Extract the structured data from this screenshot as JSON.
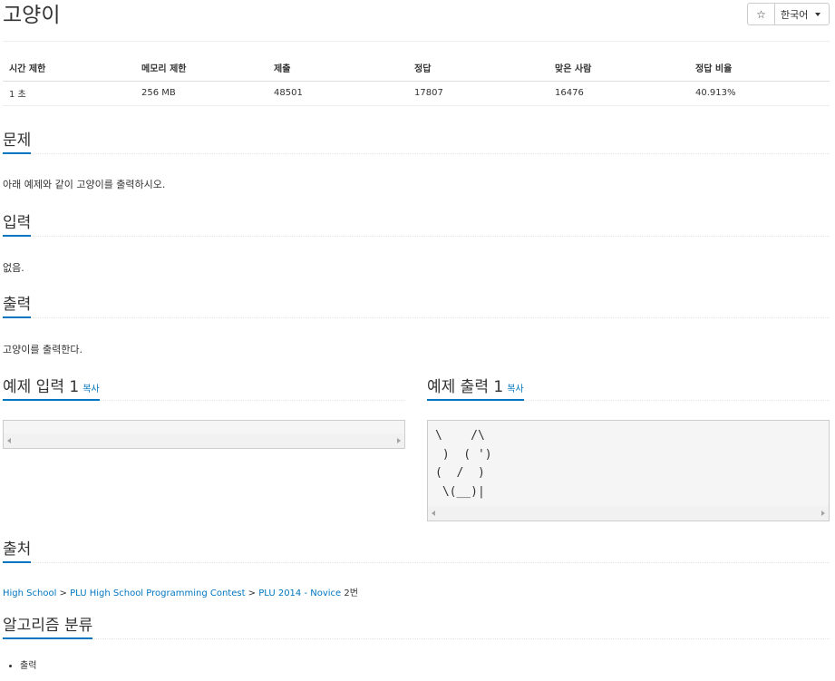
{
  "problem": {
    "title": "고양이",
    "star_label": "☆",
    "language": "한국어"
  },
  "info_table": {
    "headers": [
      "시간 제한",
      "메모리 제한",
      "제출",
      "정답",
      "맞은 사람",
      "정답 비율"
    ],
    "row": [
      "1 초",
      "256 MB",
      "48501",
      "17807",
      "16476",
      "40.913%"
    ]
  },
  "sections": {
    "description": {
      "title": "문제",
      "text": "아래 예제와 같이 고양이를 출력하시오."
    },
    "input": {
      "title": "입력",
      "text": "없음."
    },
    "output": {
      "title": "출력",
      "text": "고양이를 출력한다."
    },
    "sample_input": {
      "title": "예제 입력 1",
      "copy": "복사",
      "content": ""
    },
    "sample_output": {
      "title": "예제 출력 1",
      "copy": "복사",
      "content": "\\    /\\\n )  ( ')\n(  /  )\n \\(__)|"
    },
    "source": {
      "title": "출처",
      "links": [
        "High School",
        "PLU High School Programming Contest",
        "PLU 2014 - Novice"
      ],
      "separator": " > ",
      "suffix": "2번"
    },
    "algorithm": {
      "title": "알고리즘 분류",
      "items": [
        "출력"
      ]
    }
  },
  "colors": {
    "accent": "#0076c0",
    "text": "#333333",
    "border": "#cccccc",
    "sample_bg": "#f5f5f5"
  }
}
